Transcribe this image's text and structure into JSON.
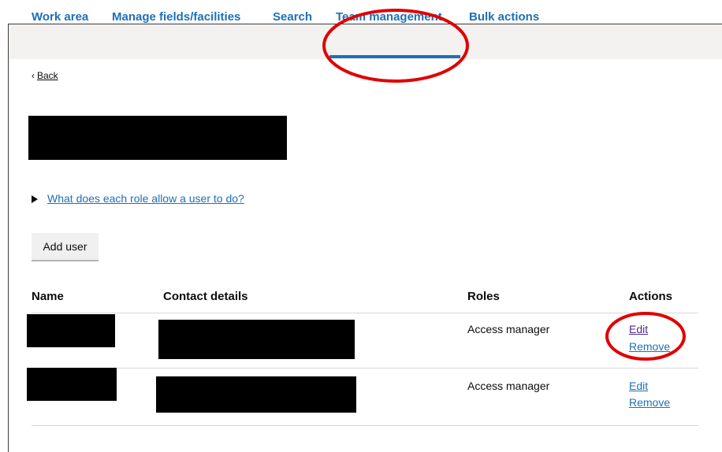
{
  "nav": {
    "items": [
      {
        "label": "Work area"
      },
      {
        "label": "Manage fields/facilities"
      },
      {
        "label": "Search"
      },
      {
        "label": "Team management"
      },
      {
        "label": "Bulk actions"
      }
    ],
    "active": "Team management"
  },
  "back_link": "Back",
  "roles_details_summary": "What does each role allow a user to do?",
  "add_user_button": "Add user",
  "table": {
    "headers": [
      "Name",
      "Contact details",
      "Roles",
      "Actions"
    ],
    "rows": [
      {
        "role": "Access manager",
        "edit": "Edit",
        "remove": "Remove"
      },
      {
        "role": "Access manager",
        "edit": "Edit",
        "remove": "Remove"
      }
    ]
  },
  "colors": {
    "link": "#1d70b8",
    "visited_link": "#4c2c92",
    "nav_background": "#f3f2f1",
    "annotation": "#e00000",
    "redaction": "#000000"
  }
}
